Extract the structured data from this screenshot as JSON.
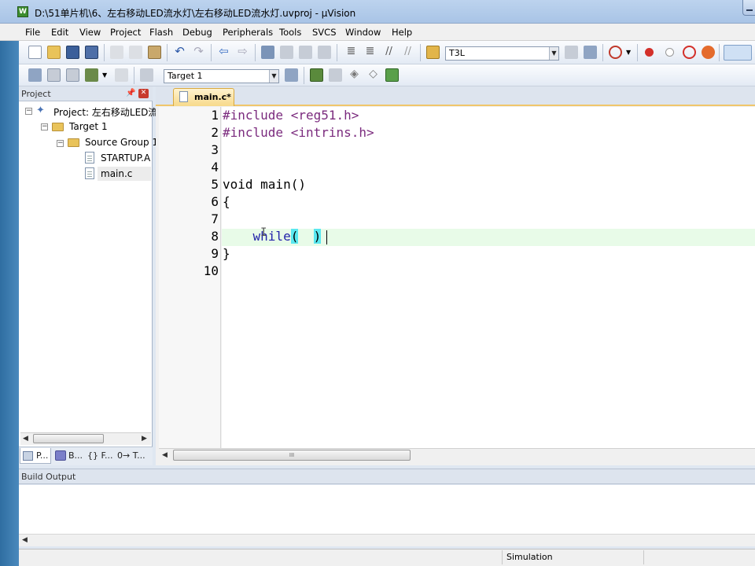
{
  "window": {
    "title": "D:\\51单片机\\6、左右移动LED流水灯\\左右移动LED流水灯.uvproj - µVision",
    "app_icon": "W"
  },
  "menubar": [
    "File",
    "Edit",
    "View",
    "Project",
    "Flash",
    "Debug",
    "Peripherals",
    "Tools",
    "SVCS",
    "Window",
    "Help"
  ],
  "toolbar": {
    "find_combo_value": "T3L",
    "target_combo_value": "Target 1"
  },
  "project_panel": {
    "title": "Project",
    "tree": {
      "project": "Project: 左右移动LED流",
      "target": "Target 1",
      "group": "Source Group 1",
      "files": [
        "STARTUP.A",
        "main.c"
      ]
    },
    "tabs": [
      "P...",
      "B...",
      "{} F...",
      "0→ T..."
    ]
  },
  "editor": {
    "tab_label": "main.c*",
    "lines": [
      {
        "num": "1",
        "parts": [
          {
            "t": "#include <reg51.h>",
            "c": "pp"
          }
        ]
      },
      {
        "num": "2",
        "parts": [
          {
            "t": "#include <intrins.h>",
            "c": "pp"
          }
        ]
      },
      {
        "num": "3",
        "parts": []
      },
      {
        "num": "4",
        "parts": []
      },
      {
        "num": "5",
        "parts": [
          {
            "t": "void main()",
            "c": ""
          }
        ]
      },
      {
        "num": "6",
        "parts": [
          {
            "t": "{",
            "c": ""
          }
        ]
      },
      {
        "num": "7",
        "parts": []
      },
      {
        "num": "8",
        "parts": [
          {
            "t": "    ",
            "c": ""
          },
          {
            "t": "while",
            "c": "kw"
          },
          {
            "t": "(",
            "c": "paren-hl"
          },
          {
            "t": "  ",
            "c": ""
          },
          {
            "t": ")",
            "c": "paren-hl"
          }
        ]
      },
      {
        "num": "9",
        "parts": [
          {
            "t": "}",
            "c": ""
          }
        ]
      },
      {
        "num": "10",
        "parts": []
      }
    ],
    "scroll_thumb_label": "III"
  },
  "build_output": {
    "title": "Build Output"
  },
  "statusbar": {
    "mode": "Simulation"
  }
}
